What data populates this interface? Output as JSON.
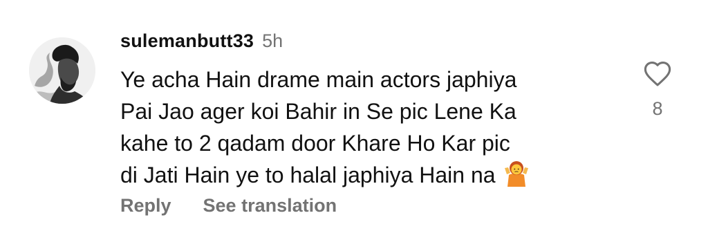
{
  "comment": {
    "username": "sulemanbutt33",
    "time": "5h",
    "text_lines": [
      "Ye acha Hain drame main actors japhiya",
      "Pai Jao ager koi Bahir in Se pic Lene Ka",
      "kahe to 2 qadam door Khare Ho Kar pic",
      "di Jati Hain ye to halal japhiya Hain na"
    ],
    "emoji": "person-shrugging-emoji",
    "likes": "8",
    "actions": {
      "reply": "Reply",
      "translate": "See translation"
    },
    "icons": {
      "like": "heart-outline-icon"
    },
    "colors": {
      "primary_text": "#111111",
      "secondary_text": "#737373"
    }
  }
}
